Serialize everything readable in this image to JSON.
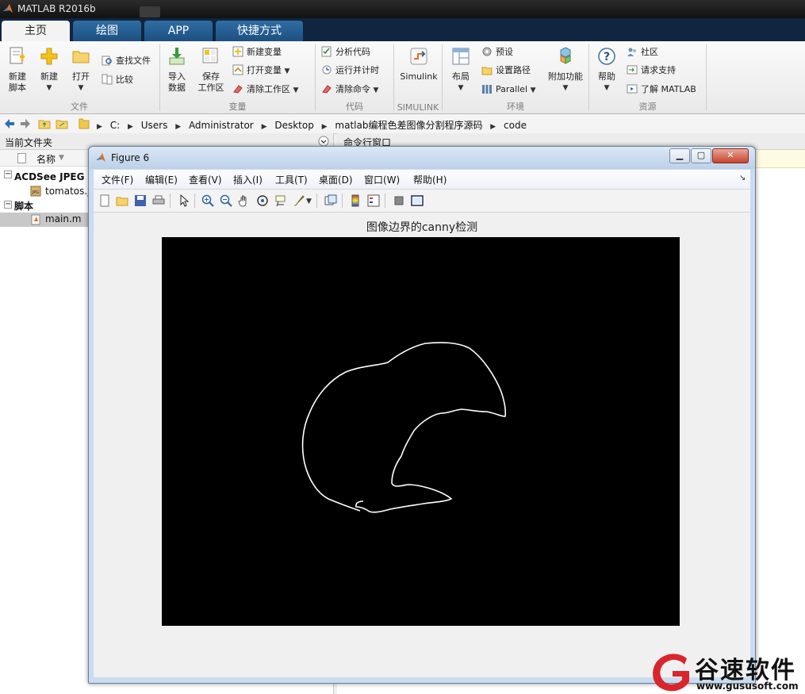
{
  "app": {
    "title": "MATLAB R2016b"
  },
  "tabs": [
    {
      "label": "主页",
      "active": true
    },
    {
      "label": "绘图",
      "active": false
    },
    {
      "label": "APP",
      "active": false
    },
    {
      "label": "快捷方式",
      "active": false
    }
  ],
  "ribbon": {
    "file": {
      "group_label": "文件",
      "new_script": "新建\n脚本",
      "new": "新建",
      "open": "打开",
      "find_files": "查找文件",
      "compare": "比较"
    },
    "variable": {
      "group_label": "变量",
      "import_data": "导入\n数据",
      "save_workspace": "保存\n工作区",
      "new_variable": "新建变量",
      "open_variable": "打开变量",
      "clear_workspace": "清除工作区"
    },
    "code": {
      "group_label": "代码",
      "analyze_code": "分析代码",
      "run_and_time": "运行并计时",
      "clear_commands": "清除命令"
    },
    "simulink": {
      "group_label": "SIMULINK",
      "simulink": "Simulink"
    },
    "environment": {
      "group_label": "环境",
      "layout": "布局",
      "preferences": "预设",
      "set_path": "设置路径",
      "parallel": "Parallel",
      "add_ons": "附加功能"
    },
    "resources": {
      "group_label": "资源",
      "help": "帮助",
      "community": "社区",
      "request_support": "请求支持",
      "learn_matlab": "了解 MATLAB"
    }
  },
  "address": {
    "crumbs": [
      "C:",
      "Users",
      "Administrator",
      "Desktop",
      "matlab编程色差图像分割程序源码",
      "code"
    ]
  },
  "current_folder": {
    "title": "当前文件夹",
    "name_col": "名称",
    "items": [
      {
        "label": "ACDSee JPEG 图",
        "kind": "group"
      },
      {
        "label": "tomatos.jpg",
        "kind": "file"
      },
      {
        "label": "脚本",
        "kind": "group"
      },
      {
        "label": "main.m",
        "kind": "file",
        "selected": true
      }
    ]
  },
  "command_window": {
    "title": "命令行窗口"
  },
  "figure": {
    "title": "Figure 6",
    "menus": [
      "文件(F)",
      "编辑(E)",
      "查看(V)",
      "插入(I)",
      "工具(T)",
      "桌面(D)",
      "窗口(W)",
      "帮助(H)"
    ],
    "toolbar_icons": [
      "new-figure-icon",
      "open-file-icon",
      "save-icon",
      "print-icon",
      "pointer-icon",
      "zoom-in-icon",
      "zoom-out-icon",
      "pan-hand-icon",
      "rotate-3d-icon",
      "data-cursor-icon",
      "brush-icon",
      "link-plot-icon",
      "colorbar-icon",
      "legend-icon",
      "hide-plot-tools-icon",
      "show-plot-tools-icon"
    ],
    "axes_title": "图像边界的canny检测"
  },
  "watermark": {
    "brand": "谷速软件",
    "url": "www.gususoft.com"
  },
  "colors": {
    "tab_strip": "#10253f",
    "tab": "#2f6ea3",
    "image_bg": "#000000",
    "edge": "#ffffff",
    "watermark_red": "#d8262c"
  }
}
